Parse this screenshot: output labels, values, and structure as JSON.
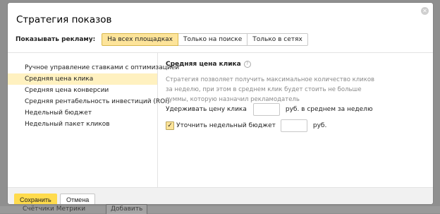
{
  "background": {
    "counters_label": "Счётчики Метрики",
    "add_button": "Добавить"
  },
  "modal": {
    "title": "Стратегия показов",
    "show_ads_label": "Показывать рекламу:",
    "placement_options": [
      "На всех площадках",
      "Только на поиске",
      "Только в сетях"
    ],
    "placement_selected": "На всех площадках",
    "strategies": [
      "Ручное управление ставками с оптимизацией",
      "Средняя цена клика",
      "Средняя цена конверсии",
      "Средняя рентабельность инвестиций (ROI)",
      "Недельный бюджет",
      "Недельный пакет кликов"
    ],
    "strategy_selected": "Средняя цена клика",
    "panel": {
      "title": "Средняя цена клика",
      "description": "Стратегия позволяет получить максимальное количество кликов за неделю, при этом в среднем клик будет стоить не больше суммы, которую назначил рекламодатель",
      "hold_price_label": "Удерживать цену клика",
      "hold_price_value": "",
      "hold_price_suffix": "руб. в среднем за неделю",
      "weekly_budget_label": "Уточнить недельный бюджет",
      "weekly_budget_checked": true,
      "weekly_budget_value": "",
      "weekly_budget_suffix": "руб."
    },
    "footer": {
      "save_label": "Сохранить",
      "cancel_label": "Отмена"
    }
  },
  "colors": {
    "accent_yellow": "#ffdb4d",
    "active_tab": "#fde49a",
    "active_row": "#fff1c0"
  },
  "icons": {
    "close": "close-icon",
    "help": "help-icon",
    "check": "check-icon"
  }
}
